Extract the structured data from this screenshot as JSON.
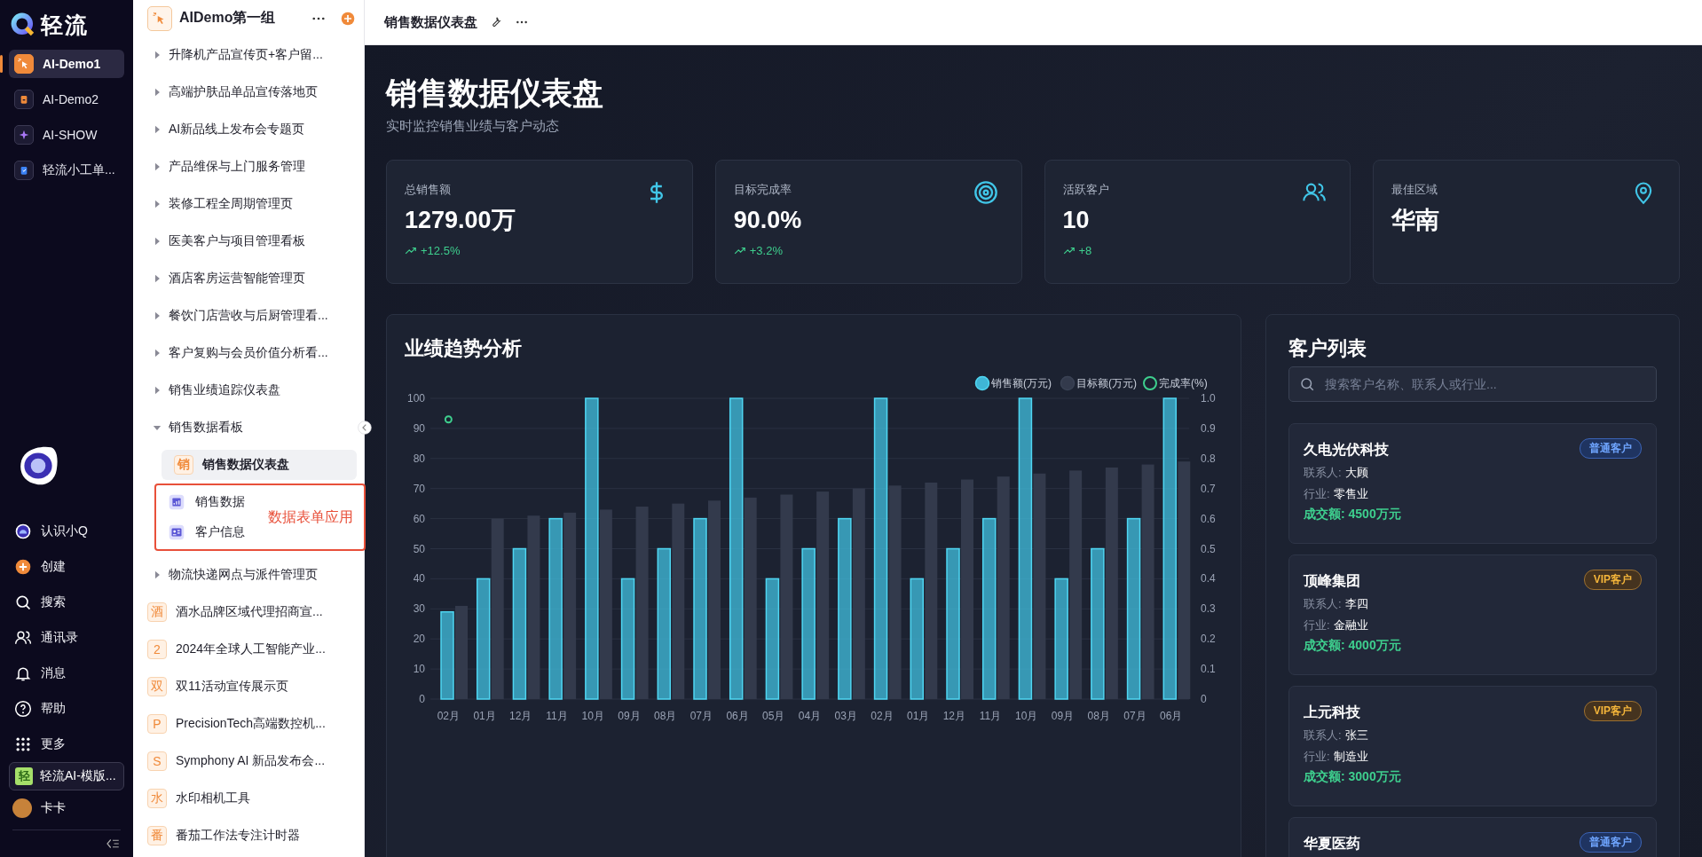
{
  "rail": {
    "logo": "轻流",
    "apps": [
      {
        "label": "AI-Demo1",
        "kind": "cursor",
        "selected": true
      },
      {
        "label": "AI-Demo2",
        "kind": "bag",
        "selected": false
      },
      {
        "label": "AI-SHOW",
        "kind": "sparkle",
        "selected": false
      },
      {
        "label": "轻流小工单...",
        "kind": "clipboard",
        "selected": false
      }
    ],
    "nav": [
      {
        "label": "认识小Q",
        "kind": "assistant"
      },
      {
        "label": "创建",
        "kind": "create"
      },
      {
        "label": "搜索",
        "kind": "search"
      },
      {
        "label": "通讯录",
        "kind": "contacts"
      },
      {
        "label": "消息",
        "kind": "bell"
      },
      {
        "label": "帮助",
        "kind": "help"
      },
      {
        "label": "更多",
        "kind": "grid"
      }
    ],
    "template": {
      "icon_char": "轻",
      "label": "轻流AI-模版..."
    },
    "user": "卡卡"
  },
  "sidebar": {
    "group": "AIDemo第一组",
    "annotation": "数据表单应用",
    "items": [
      {
        "label": "升降机产品宣传页+客户留...",
        "kind": "folder",
        "expanded": false,
        "selected": false
      },
      {
        "label": "高端护肤品单品宣传落地页",
        "kind": "folder",
        "expanded": false,
        "selected": false
      },
      {
        "label": "AI新品线上发布会专题页",
        "kind": "folder",
        "expanded": false,
        "selected": false
      },
      {
        "label": "产品维保与上门服务管理",
        "kind": "folder",
        "expanded": false,
        "selected": false
      },
      {
        "label": "装修工程全周期管理页",
        "kind": "folder",
        "expanded": false,
        "selected": false
      },
      {
        "label": "医美客户与项目管理看板",
        "kind": "folder",
        "expanded": false,
        "selected": false
      },
      {
        "label": "酒店客房运营智能管理页",
        "kind": "folder",
        "expanded": false,
        "selected": false
      },
      {
        "label": "餐饮门店营收与后厨管理看...",
        "kind": "folder",
        "expanded": false,
        "selected": false
      },
      {
        "label": "客户复购与会员价值分析看...",
        "kind": "folder",
        "expanded": false,
        "selected": false
      },
      {
        "label": "销售业绩追踪仪表盘",
        "kind": "folder",
        "expanded": false,
        "selected": false
      },
      {
        "label": "销售数据看板",
        "kind": "folder",
        "expanded": true,
        "selected": false,
        "children": [
          {
            "label": "销售数据仪表盘",
            "kind": "page",
            "icon_char": "销",
            "selected": true,
            "annotated": false
          },
          {
            "label": "销售数据",
            "kind": "report",
            "selected": false,
            "annotated": true
          },
          {
            "label": "客户信息",
            "kind": "contact-card",
            "selected": false,
            "annotated": true
          }
        ]
      },
      {
        "label": "物流快递网点与派件管理页",
        "kind": "folder",
        "expanded": false,
        "selected": false
      },
      {
        "label": "酒水品牌区域代理招商宣...",
        "kind": "page",
        "icon_char": "酒",
        "selected": false
      },
      {
        "label": "2024年全球人工智能产业...",
        "kind": "page",
        "icon_char": "2",
        "selected": false
      },
      {
        "label": "双11活动宣传展示页",
        "kind": "page",
        "icon_char": "双",
        "selected": false
      },
      {
        "label": "PrecisionTech高端数控机...",
        "kind": "page",
        "icon_char": "P",
        "selected": false
      },
      {
        "label": "Symphony AI 新品发布会...",
        "kind": "page",
        "icon_char": "S",
        "selected": false
      },
      {
        "label": "水印相机工具",
        "kind": "page",
        "icon_char": "水",
        "selected": false
      },
      {
        "label": "番茄工作法专注计时器",
        "kind": "page",
        "icon_char": "番",
        "selected": false
      }
    ]
  },
  "header": {
    "title": "销售数据仪表盘"
  },
  "dashboard": {
    "title": "销售数据仪表盘",
    "subtitle": "实时监控销售业绩与客户动态",
    "kpis": [
      {
        "label": "总销售额",
        "value": "1279.00万",
        "trend": "+12.5%",
        "kind": "dollar"
      },
      {
        "label": "目标完成率",
        "value": "90.0%",
        "trend": "+3.2%",
        "kind": "target"
      },
      {
        "label": "活跃客户",
        "value": "10",
        "trend": "+8",
        "kind": "users"
      },
      {
        "label": "最佳区域",
        "value": "华南",
        "kind": "pin"
      }
    ],
    "trend_panel": {
      "title": "业绩趋势分析",
      "chart_data": {
        "type": "bar",
        "categories": [
          "02月",
          "01月",
          "12月",
          "11月",
          "10月",
          "09月",
          "08月",
          "07月",
          "06月",
          "05月",
          "04月",
          "03月",
          "02月",
          "01月",
          "12月",
          "11月",
          "10月",
          "09月",
          "08月",
          "07月",
          "06月"
        ],
        "series": [
          {
            "name": "销售额(万元)",
            "color": "#3fb6d6",
            "values": [
              29,
              40,
              50,
              60,
              100,
              40,
              50,
              60,
              100,
              40,
              50,
              60,
              100,
              40,
              50,
              60,
              100,
              40,
              50,
              60,
              100
            ]
          },
          {
            "name": "目标额(万元)",
            "color": "#333a4c",
            "values": [
              31,
              60,
              61,
              62,
              63,
              64,
              65,
              66,
              67,
              68,
              69,
              70,
              71,
              72,
              73,
              74,
              75,
              76,
              77,
              78,
              79
            ]
          },
          {
            "name": "完成率(%)",
            "type": "line",
            "marker": "circle",
            "axis": "y2",
            "color": "#3ecf8e",
            "values": [
              0.93,
              null,
              null,
              null,
              null,
              null,
              null,
              null,
              null,
              null,
              null,
              null,
              null,
              null,
              null,
              null,
              null,
              null,
              null,
              null,
              null
            ]
          }
        ],
        "grid": true,
        "legend": "top-right",
        "ylim": [
          0,
          100
        ],
        "yticks": [
          0,
          10,
          20,
          30,
          40,
          50,
          60,
          70,
          80,
          90,
          100
        ],
        "y2lim": [
          0,
          1
        ],
        "y2ticks": [
          {
            "value": 0,
            "label": "0"
          },
          {
            "value": 0.1,
            "label": "0.1"
          },
          {
            "value": 0.2,
            "label": "0.2"
          },
          {
            "value": 0.3,
            "label": "0.3"
          },
          {
            "value": 0.4,
            "label": "0.4"
          },
          {
            "value": 0.5,
            "label": "0.5"
          },
          {
            "value": 0.6,
            "label": "0.6"
          },
          {
            "value": 0.7,
            "label": "0.7"
          },
          {
            "value": 0.8,
            "label": "0.8"
          },
          {
            "value": 0.9,
            "label": "0.9"
          },
          {
            "value": 1,
            "label": "1.0"
          }
        ]
      }
    },
    "customers": {
      "title": "客户列表",
      "search": {
        "placeholder": "搜索客户名称、联系人或行业..."
      },
      "items": [
        {
          "name": "久电光伏科技",
          "badge": {
            "label": "普通客户",
            "kind": "regular"
          },
          "fields": [
            {
              "label": "联系人:",
              "value": "大顾"
            },
            {
              "label": "行业:",
              "value": "零售业"
            }
          ],
          "deal": "成交额: 4500万元"
        },
        {
          "name": "顶峰集团",
          "badge": {
            "label": "VIP客户",
            "kind": "vip"
          },
          "fields": [
            {
              "label": "联系人:",
              "value": "李四"
            },
            {
              "label": "行业:",
              "value": "金融业"
            }
          ],
          "deal": "成交额: 4000万元"
        },
        {
          "name": "上元科技",
          "badge": {
            "label": "VIP客户",
            "kind": "vip"
          },
          "fields": [
            {
              "label": "联系人:",
              "value": "张三"
            },
            {
              "label": "行业:",
              "value": "制造业"
            }
          ],
          "deal": "成交额: 3000万元"
        },
        {
          "name": "华夏医药",
          "badge": {
            "label": "普通客户",
            "kind": "regular"
          }
        }
      ]
    }
  }
}
